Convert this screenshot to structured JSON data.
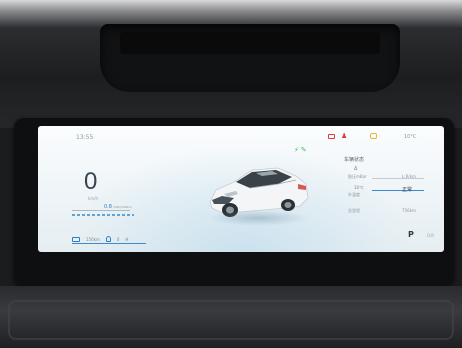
{
  "status": {
    "time": "13:55",
    "temperature": "10°C"
  },
  "speedometer": {
    "speed": "0",
    "unit": "km/h",
    "range_value": "0.8",
    "range_unit": "kWh/100km"
  },
  "bottom_strip": {
    "battery_range": "156km",
    "odometer": "0",
    "extra": "H"
  },
  "info_panel": {
    "title": "车辆状态",
    "rows": [
      {
        "symbol": "Δ",
        "left_label": "胎压mBar",
        "right_label": "L:R/km"
      },
      {
        "symbol": "10℃",
        "left_label": "外温度",
        "right_label": "正常"
      },
      {
        "symbol": "",
        "left_label": "总里程",
        "right_label": "756km"
      }
    ]
  },
  "gear": {
    "current": "P",
    "sub": "D/R"
  },
  "colors": {
    "accent_blue": "#3b8bd0",
    "warning_red": "#e13a3a",
    "warning_amber": "#e6b83a",
    "charge_green": "#3fbf6a"
  },
  "icons": {
    "charge_indicator": "⚡✎",
    "seatbelt_warning": "♟"
  }
}
